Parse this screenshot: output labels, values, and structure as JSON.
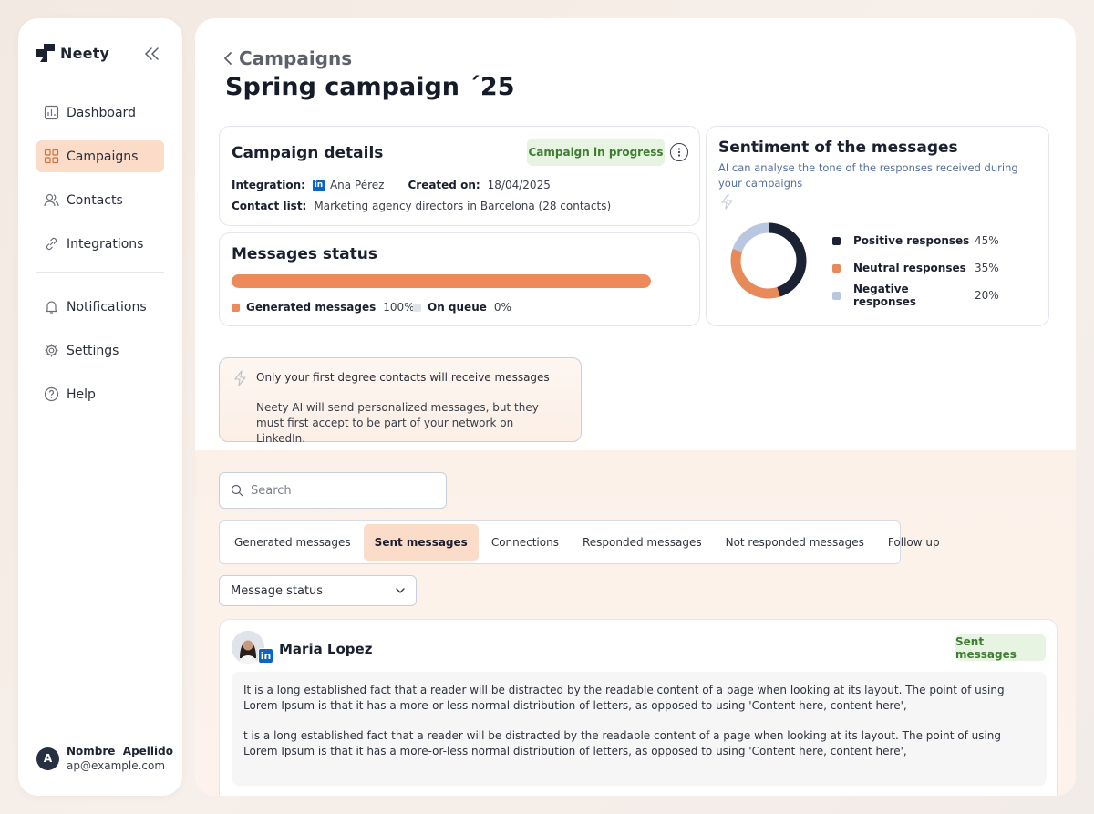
{
  "brand": {
    "name": "Neety",
    "icon": "neety-logo-icon",
    "collapse_icon": "double-chevron-left-icon"
  },
  "sidebar": {
    "items": [
      {
        "label": "Dashboard",
        "icon": "chart-icon",
        "active": false
      },
      {
        "label": "Campaigns",
        "icon": "grid-icon",
        "active": true
      },
      {
        "label": "Contacts",
        "icon": "users-icon",
        "active": false
      },
      {
        "label": "Integrations",
        "icon": "link-icon",
        "active": false
      },
      {
        "label": "Notifications",
        "icon": "bell-icon",
        "active": false
      },
      {
        "label": "Settings",
        "icon": "gear-icon",
        "active": false
      },
      {
        "label": "Help",
        "icon": "help-icon",
        "active": false
      }
    ],
    "user": {
      "initial": "A",
      "name": "Nombre  Apellido",
      "email": "ap@example.com"
    }
  },
  "header": {
    "back_label": "Campaigns",
    "title": "Spring campaign ´25"
  },
  "details": {
    "title": "Campaign details",
    "status": "Campaign in progress",
    "integration_key": "Integration:",
    "integration_value": "Ana Pérez",
    "created_key": "Created on:",
    "created_value": "18/04/2025",
    "contact_key": "Contact list:",
    "contact_value": "Marketing agency directors in Barcelona (28 contacts)"
  },
  "messages_status": {
    "title": "Messages status",
    "progress": 1.0,
    "generated_label": "Generated messages",
    "generated_value": "100%",
    "queue_label": "On queue",
    "queue_value": "0%",
    "colors": {
      "generated": "#ec8a59",
      "queue": "#dfe3ec"
    }
  },
  "sentiment": {
    "title": "Sentiment of the messages",
    "subtitle": "AI can analyse the tone of the responses received during your campaigns",
    "rows": [
      {
        "label": "Positive responses",
        "value": "45%",
        "share": 45,
        "color": "#1b2233"
      },
      {
        "label": "Neutral responses",
        "value": "35%",
        "share": 35,
        "color": "#e8895a"
      },
      {
        "label": "Negative responses",
        "value": "20%",
        "share": 20,
        "color": "#b9c8e0"
      }
    ]
  },
  "notice": {
    "title": "Only your first degree contacts will receive messages",
    "body": "Neety AI will send personalized messages, but they must first accept to be part of your network on LinkedIn."
  },
  "search": {
    "placeholder": "Search",
    "value": ""
  },
  "tabs": [
    {
      "label": "Generated messages",
      "active": false
    },
    {
      "label": "Sent messages",
      "active": true
    },
    {
      "label": "Connections",
      "active": false
    },
    {
      "label": "Responded messages",
      "active": false
    },
    {
      "label": "Not responded messages",
      "active": false
    },
    {
      "label": "Follow up",
      "active": false
    }
  ],
  "filter": {
    "label": "Message status"
  },
  "message": {
    "name": "Maria Lopez",
    "badge": "Sent messages",
    "paragraphs": [
      "It is a long established fact that a reader will be distracted by the readable content of a page when looking at its layout. The point of using Lorem Ipsum is that it has a more-or-less normal distribution of letters, as opposed to using 'Content here, content here',",
      "t is a long established fact that a reader will be distracted by the readable content of a page when looking at its layout. The point of using Lorem Ipsum is that it has a more-or-less normal distribution of letters, as opposed to using 'Content here, content here',"
    ]
  }
}
